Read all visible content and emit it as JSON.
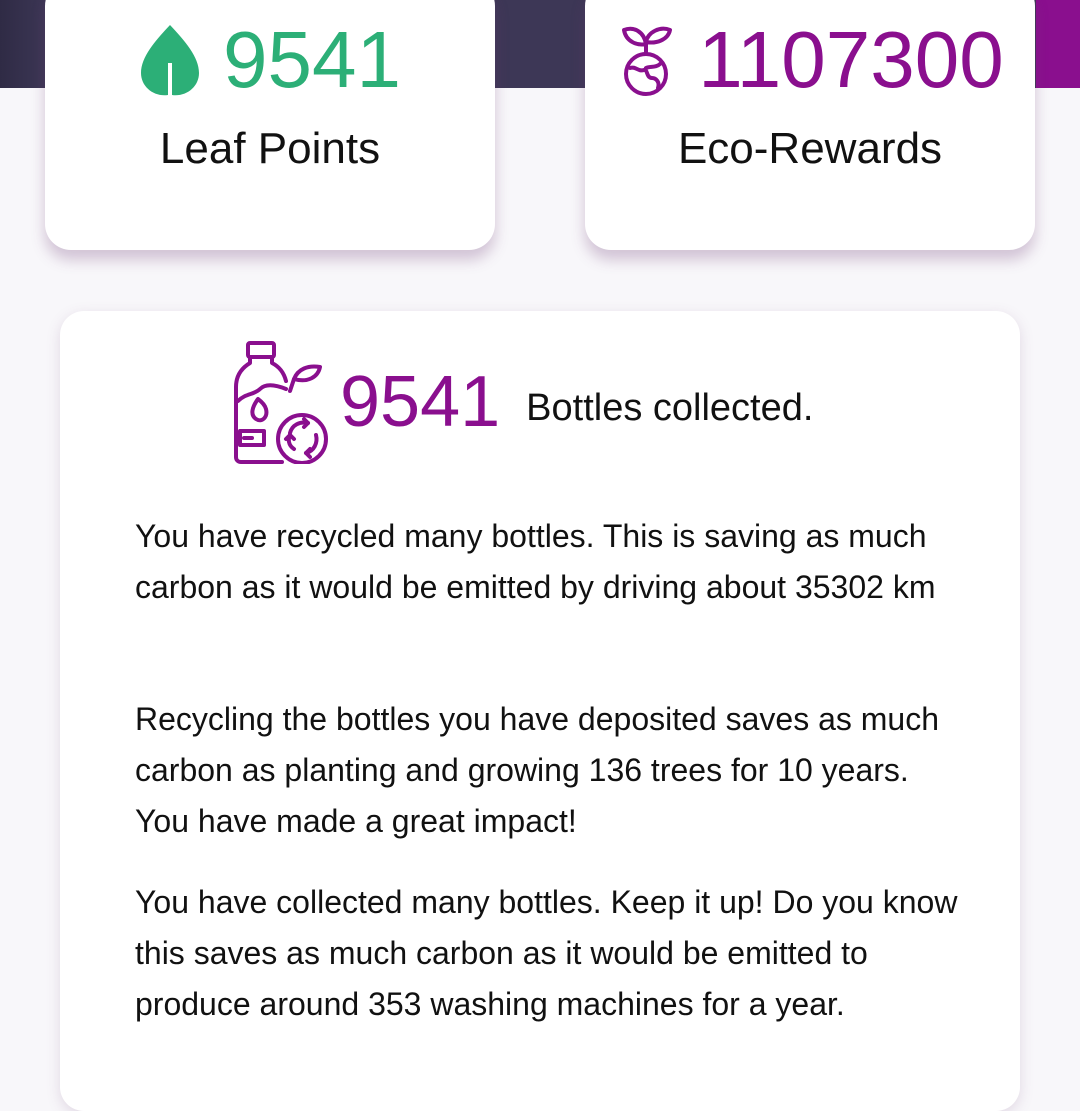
{
  "stats": {
    "leaf_points": {
      "value": "9541",
      "label": "Leaf Points",
      "icon": "leaf-icon",
      "color": "#2caf77"
    },
    "eco_rewards": {
      "value": "1107300",
      "label": "Eco-Rewards",
      "icon": "sprouting-globe-icon",
      "color": "#8a0f8e"
    }
  },
  "bottles": {
    "count": "9541",
    "label": "Bottles collected.",
    "icon": "bottle-recycle-icon",
    "color": "#8a0f8e"
  },
  "impact_messages": [
    "You have recycled many bottles. This is saving as much carbon as it would be emitted by driving about 35302 km",
    "Recycling the bottles you have deposited saves as much carbon as planting and growing 136 trees for 10 years. You have made a great impact!",
    "You have collected many bottles. Keep it up! Do you know this saves as much carbon as it would be emitted to produce around 353 washing machines for a year."
  ],
  "colors": {
    "header_background": "#3d3756",
    "accent_purple": "#8a0f8e",
    "accent_green": "#2caf77",
    "page_background": "#f8f7fa"
  }
}
